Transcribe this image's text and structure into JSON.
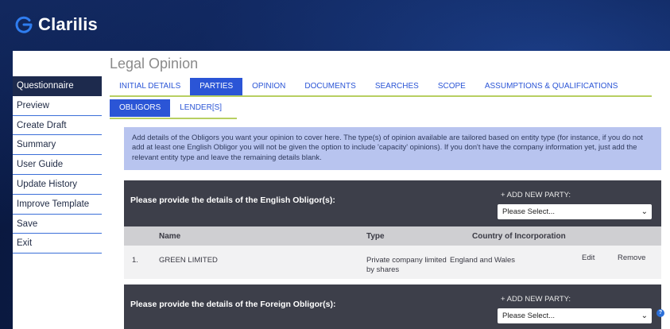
{
  "brand": {
    "name": "Clarilis"
  },
  "page_title": "Legal Opinion",
  "sidebar": {
    "items": [
      {
        "label": "Questionnaire",
        "active": true
      },
      {
        "label": "Preview"
      },
      {
        "label": "Create Draft"
      },
      {
        "label": "Summary"
      },
      {
        "label": "User Guide"
      },
      {
        "label": "Update History"
      },
      {
        "label": "Improve Template"
      },
      {
        "label": "Save"
      },
      {
        "label": "Exit"
      }
    ]
  },
  "tabs": [
    {
      "label": "INITIAL DETAILS"
    },
    {
      "label": "PARTIES",
      "active": true
    },
    {
      "label": "OPINION"
    },
    {
      "label": "DOCUMENTS"
    },
    {
      "label": "SEARCHES"
    },
    {
      "label": "SCOPE"
    },
    {
      "label": "ASSUMPTIONS & QUALIFICATIONS"
    }
  ],
  "subtabs": [
    {
      "label": "OBLIGORS",
      "active": true
    },
    {
      "label": "LENDER[S]"
    }
  ],
  "info_text": "Add details of the Obligors you want your opinion to cover here.  The type(s) of opinion available are tailored based on entity type (for instance, if you do not add at least one English Obligor you will not be given the option to include 'capacity' opinions).  If you don't have the company information yet, just add the relevant entity type and leave the remaining details blank.",
  "english_section": {
    "title": "Please provide the details of the English Obligor(s):",
    "add_label": "+ ADD NEW PARTY:",
    "select_value": "Please Select..."
  },
  "table": {
    "headers": {
      "name": "Name",
      "type": "Type",
      "country": "Country of Incorporation"
    },
    "rows": [
      {
        "index": "1.",
        "name": "GREEN LIMITED",
        "type_line1": "Private company limited",
        "type_line2": "by shares",
        "country": "England and Wales",
        "edit": "Edit",
        "remove": "Remove"
      }
    ]
  },
  "foreign_section": {
    "title": "Please provide the details of the Foreign Obligor(s):",
    "add_label": "+ ADD NEW PARTY:",
    "select_value": "Please Select..."
  },
  "colors": {
    "accent": "#2b55d6",
    "sidebar_active": "#1d2a4d",
    "tab_underline": "#b8cf62",
    "info_bg": "#b8c4ef",
    "section_bg": "#3d3f4a"
  },
  "icons": {
    "logo": "clarilis-logo-icon",
    "select": "chevron-down-icon",
    "help": "help-icon"
  }
}
